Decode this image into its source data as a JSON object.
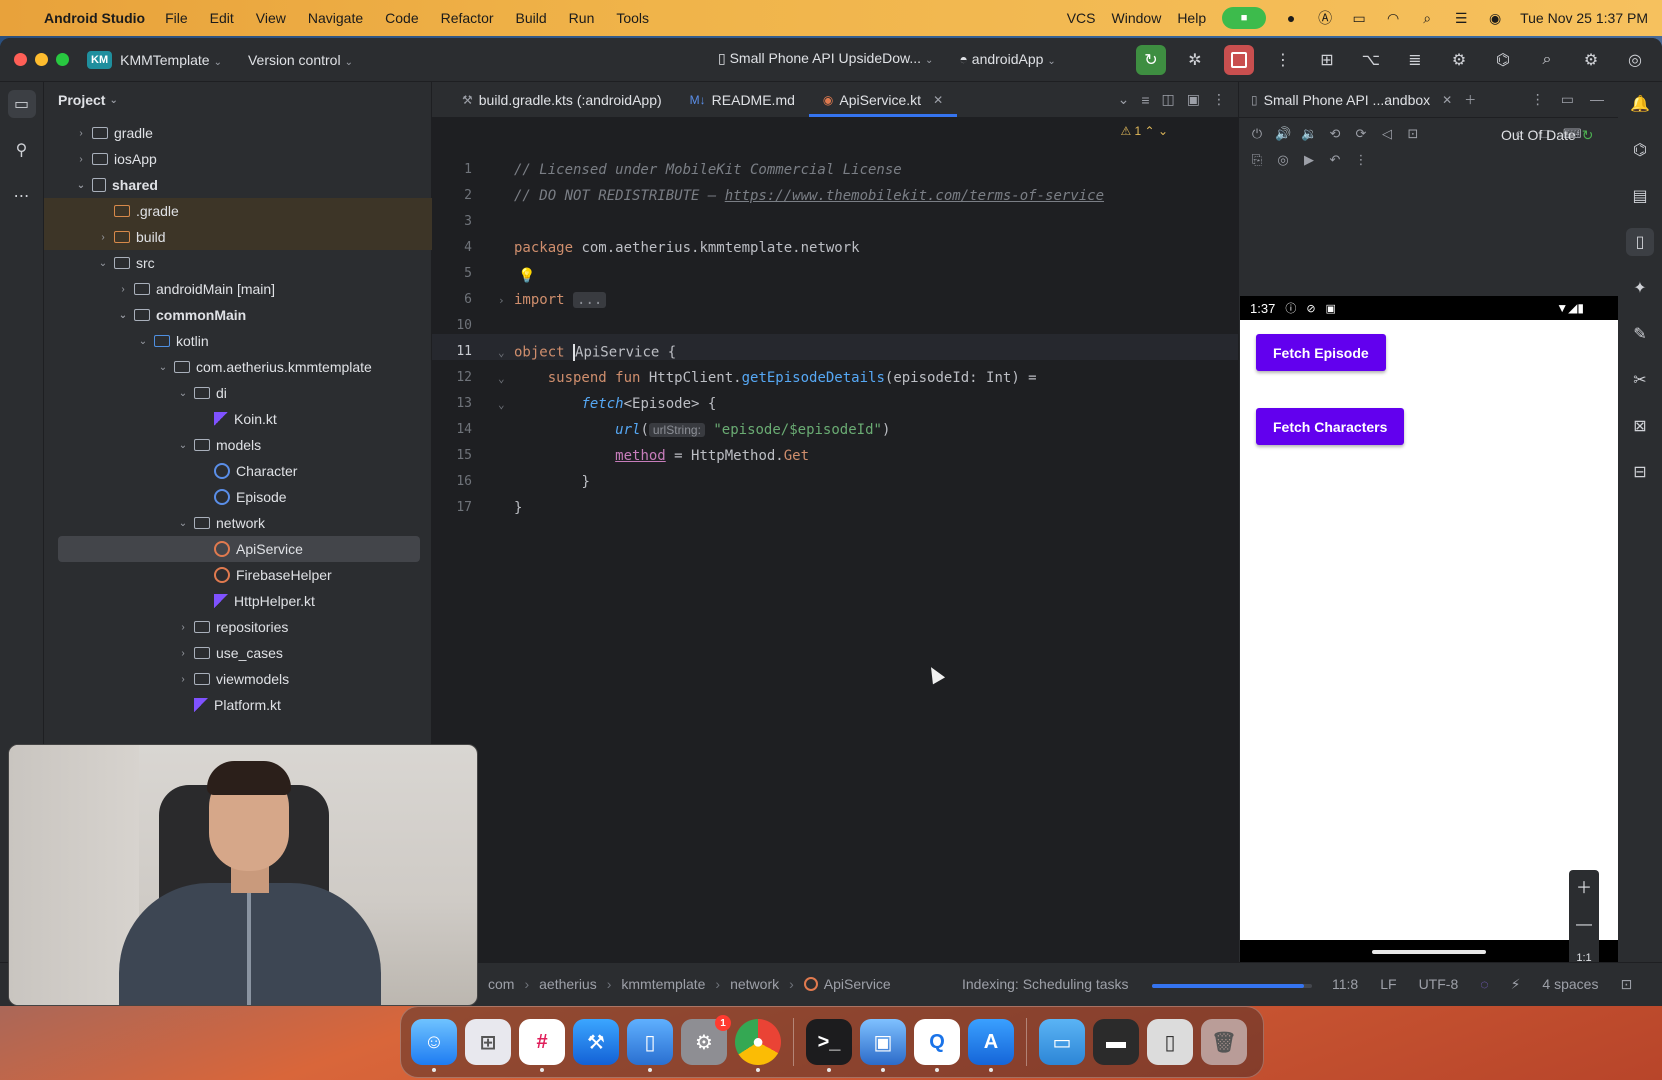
{
  "menubar": {
    "app_name": "Android Studio",
    "items": [
      "File",
      "Edit",
      "View",
      "Navigate",
      "Code",
      "Refactor",
      "Build",
      "Run",
      "Tools"
    ],
    "right_items": [
      "VCS",
      "Window",
      "Help"
    ],
    "datetime": "Tue Nov 25  1:37 PM"
  },
  "titlebar": {
    "project_badge": "KM",
    "project_name": "KMMTemplate",
    "vcs": "Version control",
    "device": "Small Phone API UpsideDow...",
    "run_config": "androidApp"
  },
  "project_panel": {
    "title": "Project",
    "tree": [
      {
        "label": "gradle",
        "arrow": "›"
      },
      {
        "label": "iosApp",
        "arrow": "›"
      },
      {
        "label": "shared",
        "arrow": "⌄"
      },
      {
        "label": ".gradle",
        "arrow": ""
      },
      {
        "label": "build",
        "arrow": "›"
      },
      {
        "label": "src",
        "arrow": "⌄"
      },
      {
        "label": "androidMain [main]",
        "arrow": "›"
      },
      {
        "label": "commonMain",
        "arrow": "⌄"
      },
      {
        "label": "kotlin",
        "arrow": "⌄"
      },
      {
        "label": "com.aetherius.kmmtemplate",
        "arrow": "⌄"
      },
      {
        "label": "di",
        "arrow": "⌄"
      },
      {
        "label": "Koin.kt",
        "arrow": ""
      },
      {
        "label": "models",
        "arrow": "⌄"
      },
      {
        "label": "Character",
        "arrow": ""
      },
      {
        "label": "Episode",
        "arrow": ""
      },
      {
        "label": "network",
        "arrow": "⌄"
      },
      {
        "label": "ApiService",
        "arrow": ""
      },
      {
        "label": "FirebaseHelper",
        "arrow": ""
      },
      {
        "label": "HttpHelper.kt",
        "arrow": ""
      },
      {
        "label": "repositories",
        "arrow": "›"
      },
      {
        "label": "use_cases",
        "arrow": "›"
      },
      {
        "label": "viewmodels",
        "arrow": "›"
      },
      {
        "label": "Platform.kt",
        "arrow": ""
      }
    ]
  },
  "editor_tabs": [
    {
      "label": "build.gradle.kts (:androidApp)",
      "icon": "gradle-icon"
    },
    {
      "label": "README.md",
      "icon": "markdown-icon"
    },
    {
      "label": "ApiService.kt",
      "icon": "object-icon",
      "active": true
    }
  ],
  "editor": {
    "warning_count": "1",
    "line_numbers": [
      "1",
      "2",
      "3",
      "4",
      "5",
      "6",
      "10",
      "11",
      "12",
      "13",
      "14",
      "15",
      "16",
      "17"
    ],
    "code": {
      "l1": "// Licensed under MobileKit Commercial License",
      "l2_prefix": "// DO NOT REDISTRIBUTE — ",
      "l2_link": "https://www.themobilekit.com/terms-of-service",
      "l4_kw": "package",
      "l4_rest": " com.aetherius.kmmtemplate.network",
      "l6_kw": "import",
      "l6_fold": "...",
      "l11_kw": "object",
      "l11_name": "ApiService",
      "l11_brace": " {",
      "l12_kw": "suspend fun",
      "l12_recv": " HttpClient.",
      "l12_fn": "getEpisodeDetails",
      "l12_rest": "(episodeId: Int) =",
      "l13_fn": "fetch",
      "l13_rest": "<Episode> {",
      "l14_fn": "url",
      "l14_open": "(",
      "l14_hint": "urlString:",
      "l14_str": "\"episode/$episodeId\"",
      "l14_close": ")",
      "l15_prop": "method",
      "l15_eq": " = HttpMethod.",
      "l15_val": "Get",
      "l16": "}",
      "l17": "}"
    }
  },
  "emulator": {
    "tab_label": "Small Phone API ...andbox",
    "out_of_date": "Out Of Date",
    "status_time": "1:37",
    "buttons": [
      "Fetch Episode",
      "Fetch Characters"
    ],
    "zoom_ratio": "1:1"
  },
  "statusbar": {
    "breadcrumb": [
      "com",
      "aetherius",
      "kmmtemplate",
      "network",
      "ApiService"
    ],
    "indexing": "Indexing: Scheduling tasks",
    "indexing_progress": 0.95,
    "position": "11:8",
    "line_sep": "LF",
    "encoding": "UTF-8",
    "indent": "4 spaces"
  },
  "dock": {
    "apps": [
      "finder",
      "launchpad",
      "slack",
      "xcode",
      "simulator",
      "system-settings",
      "chrome",
      "terminal",
      "preview",
      "quicktime",
      "app-store",
      "files",
      "screen",
      "device",
      "trash"
    ]
  }
}
